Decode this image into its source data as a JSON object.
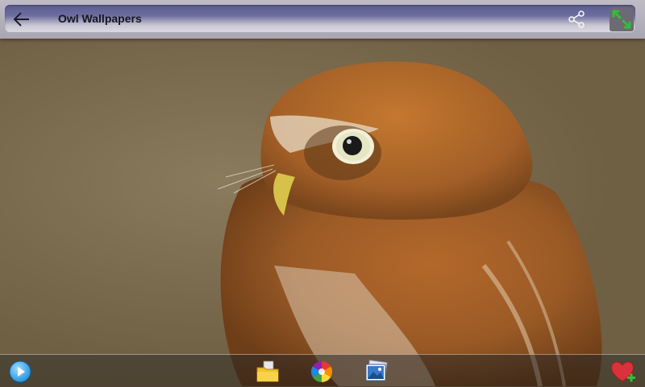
{
  "app_bar": {
    "title": "Owl Wallpapers",
    "back_icon": "arrow-left-icon",
    "share_icon": "share-icon",
    "fullscreen_icon": "expand-arrows-icon"
  },
  "wallpaper": {
    "subject": "owl-photo"
  },
  "bottom_toolbar": {
    "buttons": [
      {
        "icon": "play-slideshow-icon"
      },
      {
        "icon": "folder-icon"
      },
      {
        "icon": "color-wheel-icon"
      },
      {
        "icon": "gallery-images-icon"
      },
      {
        "icon": "heart-add-favorite-icon"
      }
    ]
  },
  "colors": {
    "topbar_bg": "#a9a6b3",
    "accent_green": "#2fbf3a",
    "heart_red": "#d9323a",
    "play_blue": "#1e8fd8"
  }
}
